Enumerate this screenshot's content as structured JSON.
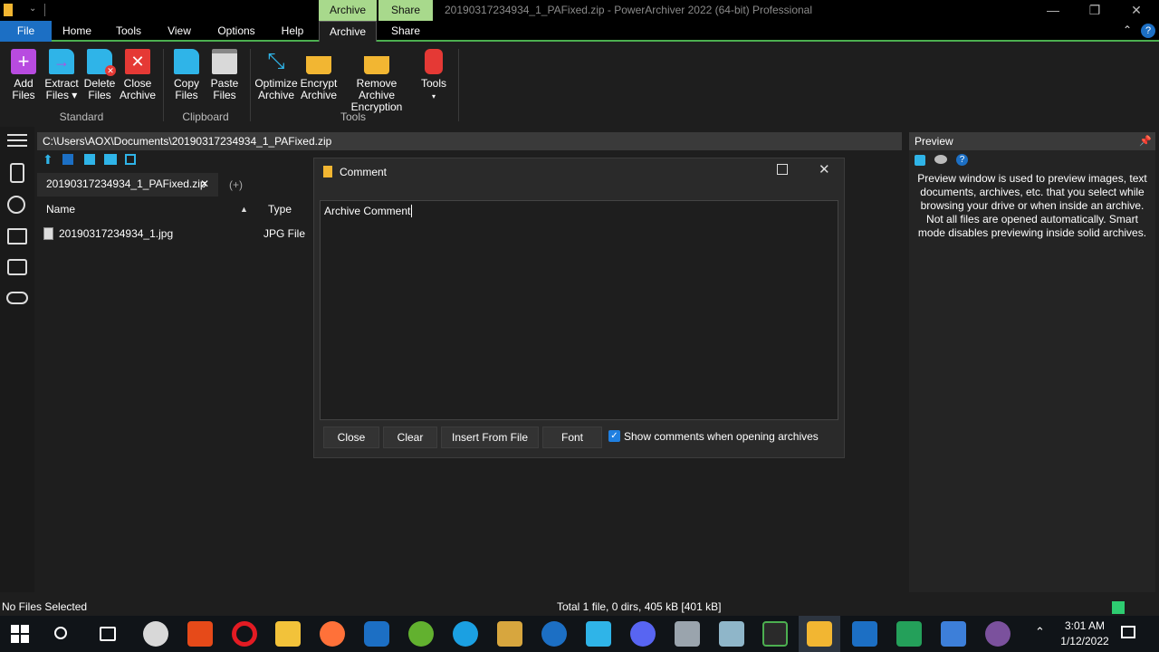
{
  "window": {
    "title": "20190317234934_1_PAFixed.zip - PowerArchiver 2022 (64-bit) Professional",
    "context_tabs": [
      "Archive",
      "Share"
    ]
  },
  "menu": [
    "File",
    "Home",
    "Tools",
    "View",
    "Options",
    "Help",
    "Archive",
    "Share"
  ],
  "ribbon": {
    "buttons": [
      {
        "label1": "Add",
        "label2": "Files"
      },
      {
        "label1": "Extract",
        "label2": "Files ▾"
      },
      {
        "label1": "Delete",
        "label2": "Files"
      },
      {
        "label1": "Close",
        "label2": "Archive"
      },
      {
        "label1": "Copy",
        "label2": "Files"
      },
      {
        "label1": "Paste",
        "label2": "Files"
      },
      {
        "label1": "Optimize",
        "label2": "Archive"
      },
      {
        "label1": "Encrypt",
        "label2": "Archive"
      },
      {
        "label1": "Remove Archive",
        "label2": "Encryption"
      },
      {
        "label1": "Tools",
        "label2": "▾"
      }
    ],
    "groups": [
      "Standard",
      "Clipboard",
      "Tools"
    ]
  },
  "path": "C:\\Users\\AOX\\Documents\\20190317234934_1_PAFixed.zip",
  "tab": {
    "label": "20190317234934_1_PAFixed.zip",
    "close": "✕",
    "new": "(+)"
  },
  "list": {
    "headers": [
      "Name",
      "Type"
    ],
    "rows": [
      {
        "name": "20190317234934_1.jpg",
        "type": "JPG File"
      }
    ]
  },
  "preview": {
    "title": "Preview",
    "text": "Preview window is used to preview images, text documents, archives, etc. that you select while browsing your drive or when inside an archive. Not all files are opened automatically. Smart mode disables previewing inside solid archives."
  },
  "dialog": {
    "title": "Comment",
    "comment_text": "Archive Comment",
    "buttons": [
      "Close",
      "Clear",
      "Insert From File",
      "Font"
    ],
    "checkbox_label": "Show comments when opening archives",
    "checkbox_checked": true
  },
  "status": {
    "left": "No Files Selected",
    "middle": "Total 1 file, 0 dirs, 405 kB [401 kB]"
  },
  "taskbar": {
    "time": "3:01 AM",
    "date": "1/12/2022"
  },
  "colors": {
    "accent_green": "#4caf50",
    "file_blue": "#1c6fc4"
  }
}
